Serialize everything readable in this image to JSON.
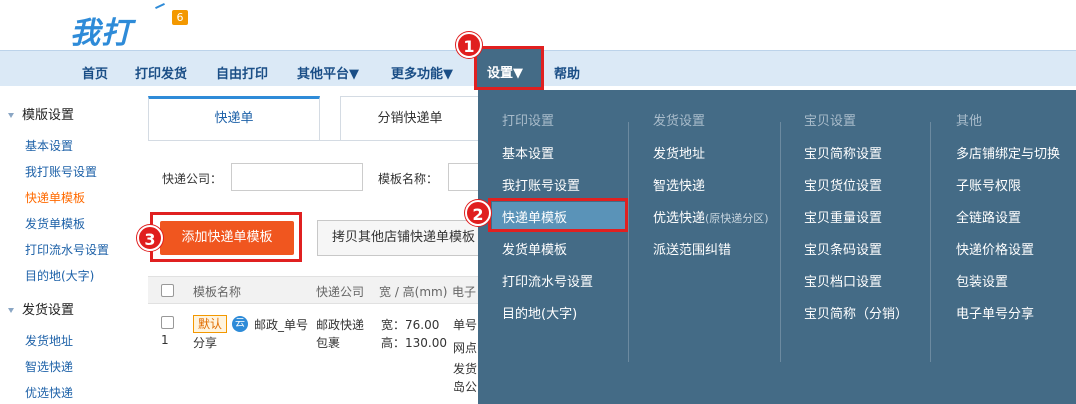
{
  "header": {
    "logo_text": "我打",
    "logo_badge": "6"
  },
  "nav": {
    "items": [
      "首页",
      "打印发货",
      "自由打印",
      "其他平台▼",
      "更多功能▼"
    ],
    "settings": "设置▼",
    "help": "帮助"
  },
  "callouts": [
    "1",
    "2",
    "3"
  ],
  "sidebar": {
    "sections": [
      {
        "title": "模版设置",
        "items": [
          "基本设置",
          "我打账号设置",
          "快递单模板",
          "发货单模板",
          "打印流水号设置",
          "目的地(大字)"
        ],
        "active_index": 2
      },
      {
        "title": "发货设置",
        "items": [
          "发货地址",
          "智选快递",
          "优选快递"
        ]
      }
    ]
  },
  "tabs": [
    "快递单",
    "分销快递单"
  ],
  "filters": {
    "company_label": "快递公司：",
    "name_label": "模板名称："
  },
  "actions": {
    "add_template": "添加快递单模板",
    "copy_template": "拷贝其他店铺快递单模板"
  },
  "table": {
    "headers": [
      "模板名称",
      "快递公司",
      "宽 / 高(mm)",
      "电子"
    ],
    "rows": [
      {
        "index": "1",
        "tag_default": "默认",
        "tag_cloud": "云",
        "name_line1": "邮政_单号",
        "name_line2": "分享",
        "company_line1": "邮政快递",
        "company_line2": "包裹",
        "width": "宽：76.00",
        "height": "高：130.00",
        "extra_lines": [
          "单号",
          "网点",
          "发货",
          "岛公"
        ]
      }
    ]
  },
  "dropdown": {
    "columns": [
      {
        "title": "打印设置",
        "items": [
          "基本设置",
          "我打账号设置",
          "快递单模板",
          "发货单模板",
          "打印流水号设置",
          "目的地(大字)"
        ],
        "highlight_index": 2
      },
      {
        "title": "发货设置",
        "items": [
          "发货地址",
          "智选快递",
          "优选快递",
          "派送范围纠错"
        ],
        "note": "(原快递分区)"
      },
      {
        "title": "宝贝设置",
        "items": [
          "宝贝简称设置",
          "宝贝货位设置",
          "宝贝重量设置",
          "宝贝条码设置",
          "宝贝档口设置",
          "宝贝简称（分销）"
        ]
      },
      {
        "title": "其他",
        "items": [
          "多店铺绑定与切换",
          "子账号权限",
          "全链路设置",
          "快递价格设置",
          "包装设置",
          "电子单号分享"
        ]
      }
    ]
  },
  "colors": {
    "accent_blue": "#2e8bd8",
    "nav_bg": "#dbe9f6",
    "dropdown_bg": "#446b86",
    "primary_button": "#f0561f",
    "callout_red": "#e01e1e",
    "active_link": "#ff6a00"
  }
}
